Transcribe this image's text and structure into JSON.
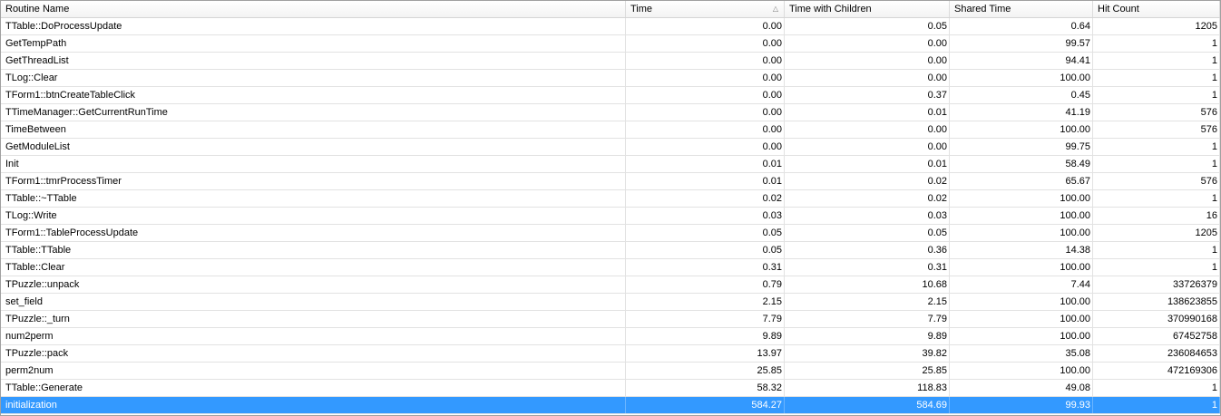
{
  "columns": [
    {
      "label": "Routine Name"
    },
    {
      "label": "Time",
      "sort_icon": "△"
    },
    {
      "label": "Time with Children"
    },
    {
      "label": "Shared Time"
    },
    {
      "label": "Hit Count"
    }
  ],
  "rows": [
    [
      "TTable::DoProcessUpdate",
      "0.00",
      "0.05",
      "0.64",
      "1205"
    ],
    [
      "GetTempPath",
      "0.00",
      "0.00",
      "99.57",
      "1"
    ],
    [
      "GetThreadList",
      "0.00",
      "0.00",
      "94.41",
      "1"
    ],
    [
      "TLog::Clear",
      "0.00",
      "0.00",
      "100.00",
      "1"
    ],
    [
      "TForm1::btnCreateTableClick",
      "0.00",
      "0.37",
      "0.45",
      "1"
    ],
    [
      "TTimeManager::GetCurrentRunTime",
      "0.00",
      "0.01",
      "41.19",
      "576"
    ],
    [
      "TimeBetween",
      "0.00",
      "0.00",
      "100.00",
      "576"
    ],
    [
      "GetModuleList",
      "0.00",
      "0.00",
      "99.75",
      "1"
    ],
    [
      "Init",
      "0.01",
      "0.01",
      "58.49",
      "1"
    ],
    [
      "TForm1::tmrProcessTimer",
      "0.01",
      "0.02",
      "65.67",
      "576"
    ],
    [
      "TTable::~TTable",
      "0.02",
      "0.02",
      "100.00",
      "1"
    ],
    [
      "TLog::Write",
      "0.03",
      "0.03",
      "100.00",
      "16"
    ],
    [
      "TForm1::TableProcessUpdate",
      "0.05",
      "0.05",
      "100.00",
      "1205"
    ],
    [
      "TTable::TTable",
      "0.05",
      "0.36",
      "14.38",
      "1"
    ],
    [
      "TTable::Clear",
      "0.31",
      "0.31",
      "100.00",
      "1"
    ],
    [
      "TPuzzle::unpack",
      "0.79",
      "10.68",
      "7.44",
      "33726379"
    ],
    [
      "set_field",
      "2.15",
      "2.15",
      "100.00",
      "138623855"
    ],
    [
      "TPuzzle::_turn",
      "7.79",
      "7.79",
      "100.00",
      "370990168"
    ],
    [
      "num2perm",
      "9.89",
      "9.89",
      "100.00",
      "67452758"
    ],
    [
      "TPuzzle::pack",
      "13.97",
      "39.82",
      "35.08",
      "236084653"
    ],
    [
      "perm2num",
      "25.85",
      "25.85",
      "100.00",
      "472169306"
    ],
    [
      "TTable::Generate",
      "58.32",
      "118.83",
      "49.08",
      "1"
    ],
    [
      "initialization",
      "584.27",
      "584.69",
      "99.93",
      "1"
    ]
  ],
  "selected_row": 22,
  "colors": {
    "selection": "#3399ff",
    "selection_text": "#ffffff",
    "grid_line": "#e2e2e2"
  }
}
